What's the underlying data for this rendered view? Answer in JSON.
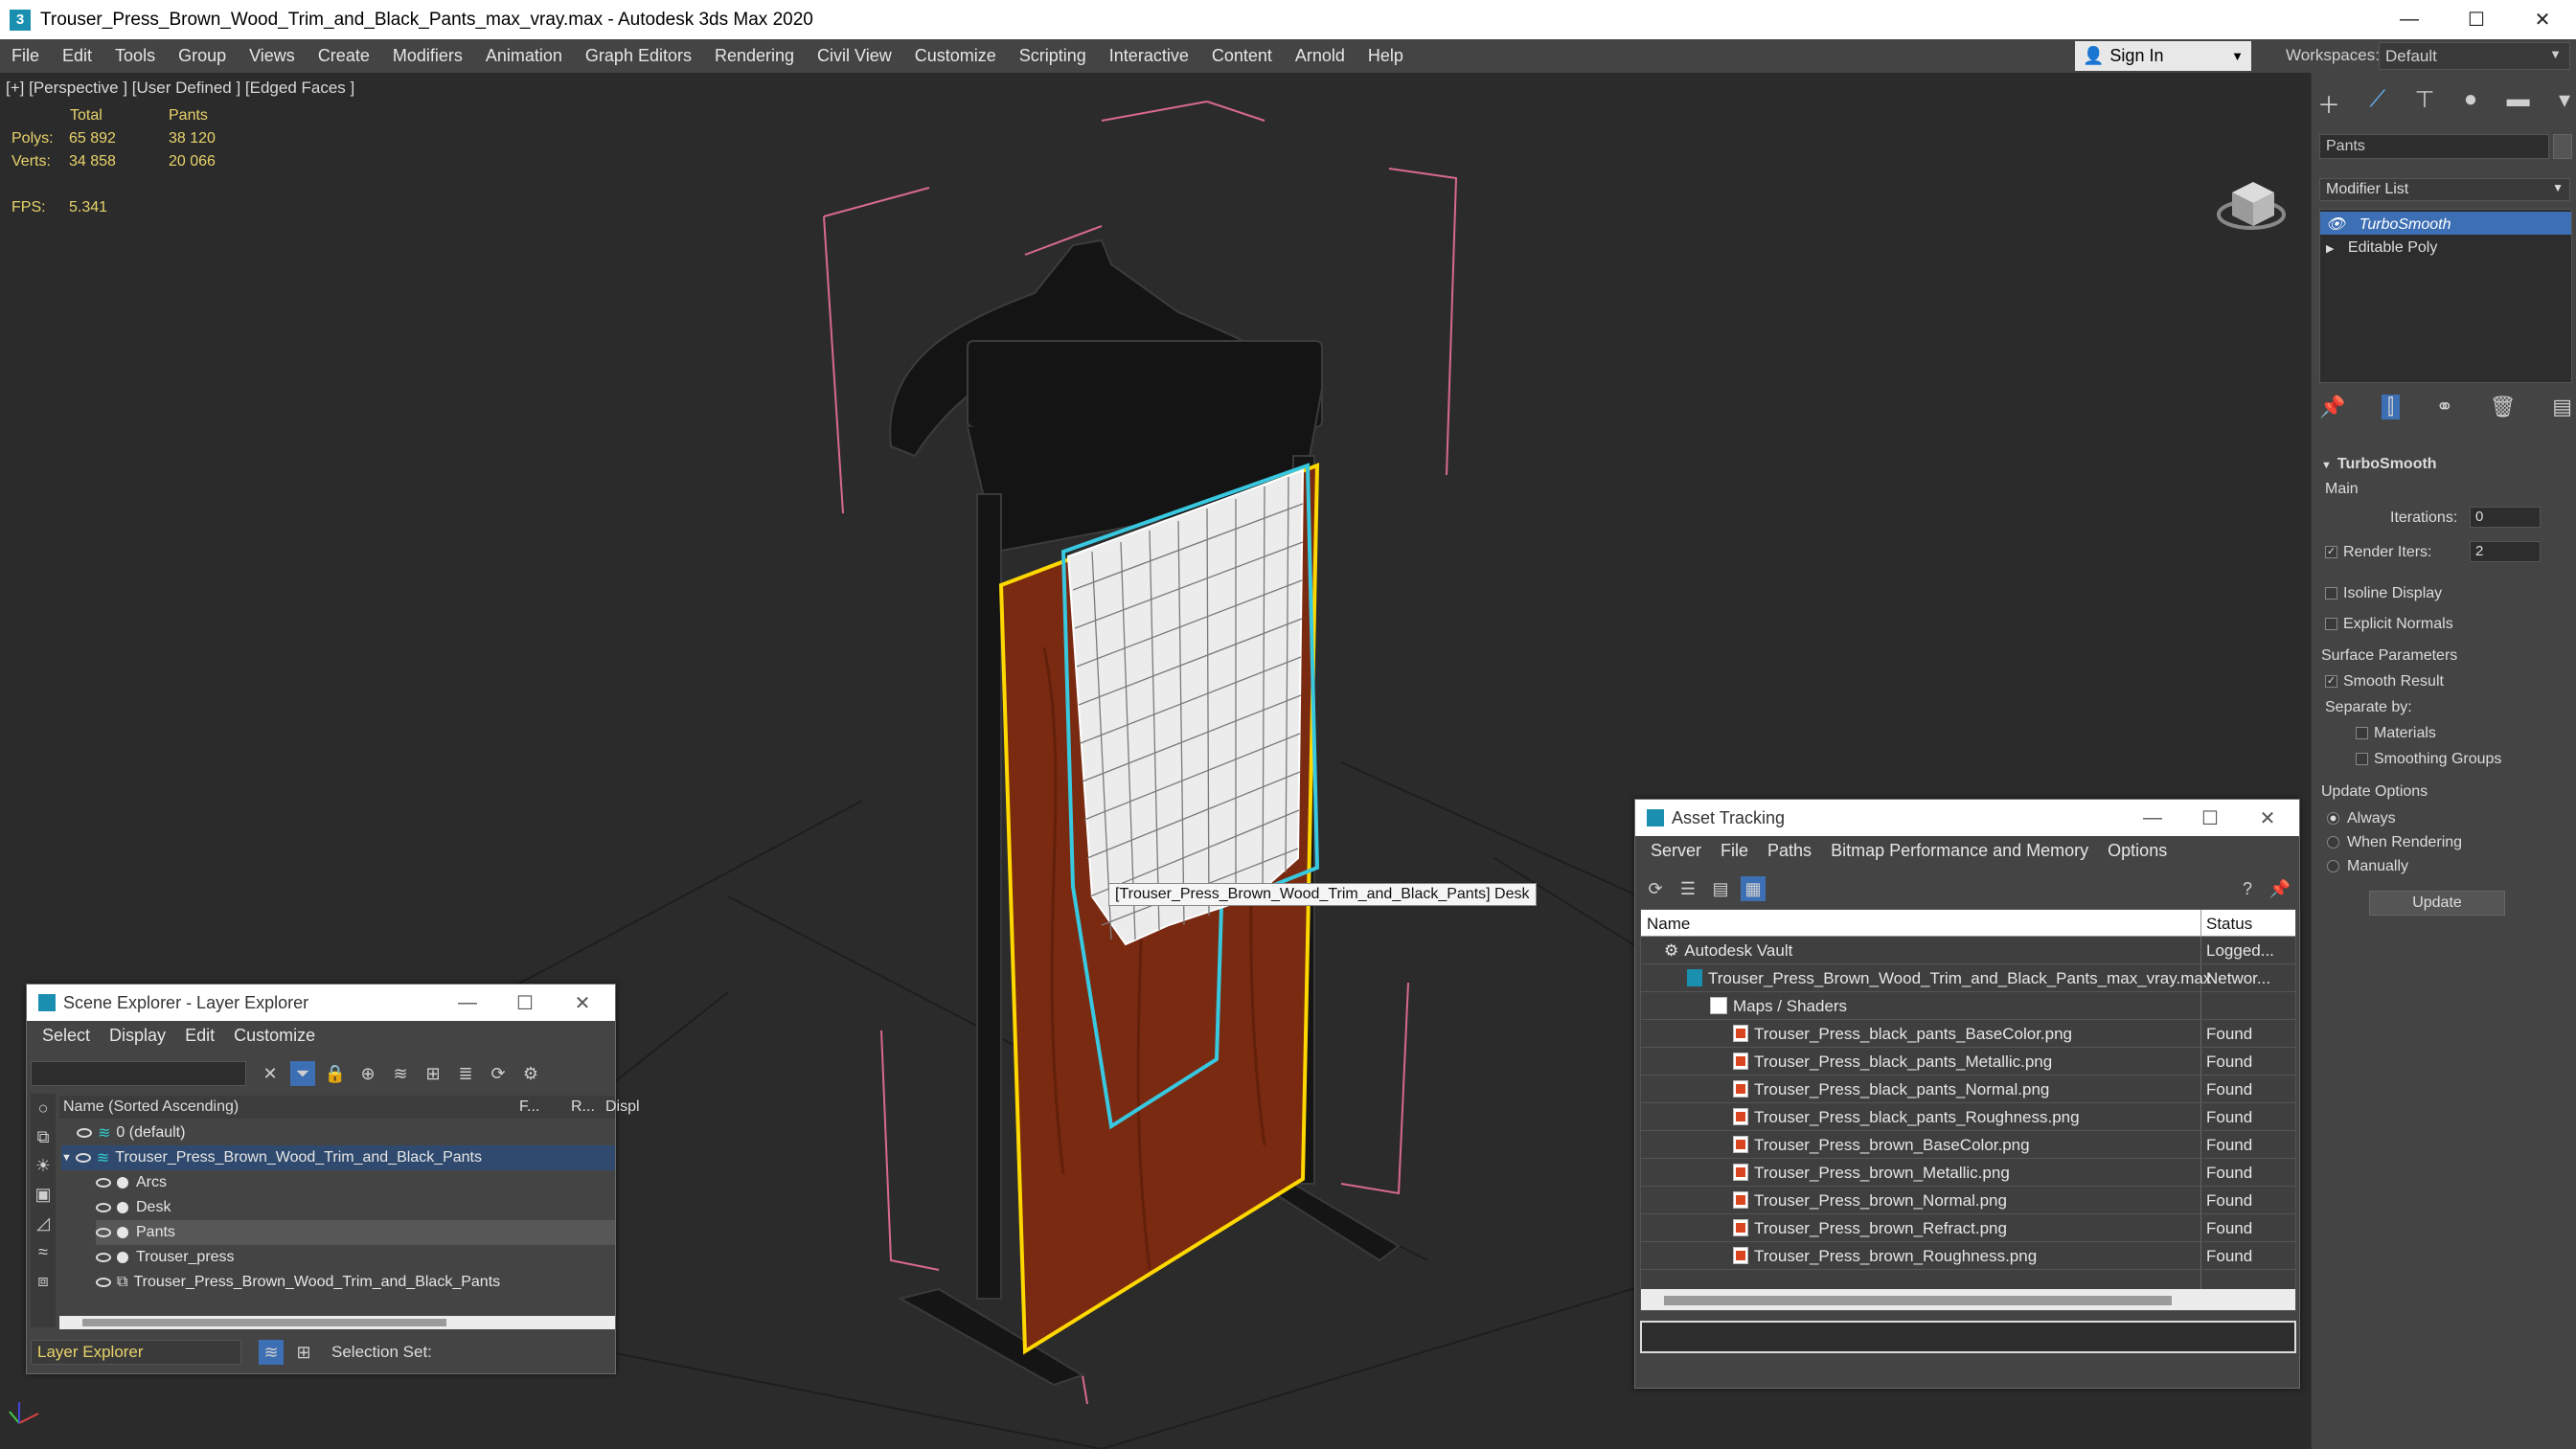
{
  "window": {
    "title": "Trouser_Press_Brown_Wood_Trim_and_Black_Pants_max_vray.max - Autodesk 3ds Max 2020",
    "minimize": "—",
    "maximize": "☐",
    "close": "✕"
  },
  "menu": [
    "File",
    "Edit",
    "Tools",
    "Group",
    "Views",
    "Create",
    "Modifiers",
    "Animation",
    "Graph Editors",
    "Rendering",
    "Civil View",
    "Customize",
    "Scripting",
    "Interactive",
    "Content",
    "Arnold",
    "Help"
  ],
  "signin": {
    "label": "Sign In"
  },
  "workspaces": {
    "label": "Workspaces:",
    "value": "Default"
  },
  "viewport": {
    "label": "[+] [Perspective ] [User Defined ] [Edged Faces ]",
    "stats": {
      "col_total": "Total",
      "col_pants": "Pants",
      "polys_label": "Polys:",
      "polys_total": "65 892",
      "polys_pants": "38 120",
      "verts_label": "Verts:",
      "verts_total": "34 858",
      "verts_pants": "20 066",
      "fps_label": "FPS:",
      "fps_value": "5.341"
    },
    "tooltip": "[Trouser_Press_Brown_Wood_Trim_and_Black_Pants] Desk"
  },
  "command_panel": {
    "object_name": "Pants",
    "modifier_list": "Modifier List",
    "stack": [
      "TurboSmooth",
      "Editable Poly"
    ],
    "rollout_title": "TurboSmooth",
    "main_label": "Main",
    "iterations_label": "Iterations:",
    "iterations_value": "0",
    "render_iters_label": "Render Iters:",
    "render_iters_value": "2",
    "isoline": "Isoline Display",
    "explicit_normals": "Explicit Normals",
    "surface_params": "Surface Parameters",
    "smooth_result": "Smooth Result",
    "separate_by": "Separate by:",
    "materials": "Materials",
    "smoothing_groups": "Smoothing Groups",
    "update_options": "Update Options",
    "always": "Always",
    "when_rendering": "When Rendering",
    "manually": "Manually",
    "update_button": "Update"
  },
  "scene_explorer": {
    "title": "Scene Explorer - Layer Explorer",
    "menu": [
      "Select",
      "Display",
      "Edit",
      "Customize"
    ],
    "col_name": "Name (Sorted Ascending)",
    "col_f": "F...",
    "col_r": "R...",
    "col_disp": "Displ",
    "rows": [
      "0 (default)",
      "Trouser_Press_Brown_Wood_Trim_and_Black_Pants",
      "Arcs",
      "Desk",
      "Pants",
      "Trouser_press",
      "Trouser_Press_Brown_Wood_Trim_and_Black_Pants"
    ],
    "footer_layer": "Layer Explorer",
    "footer_selection": "Selection Set:"
  },
  "asset_tracking": {
    "title": "Asset Tracking",
    "menu": [
      "Server",
      "File",
      "Paths",
      "Bitmap Performance and Memory",
      "Options"
    ],
    "col_name": "Name",
    "col_status": "Status",
    "rows": [
      {
        "name": "Autodesk Vault",
        "status": "Logged..."
      },
      {
        "name": "Trouser_Press_Brown_Wood_Trim_and_Black_Pants_max_vray.max",
        "status": "Networ..."
      },
      {
        "name": "Maps / Shaders",
        "status": ""
      },
      {
        "name": "Trouser_Press_black_pants_BaseColor.png",
        "status": "Found"
      },
      {
        "name": "Trouser_Press_black_pants_Metallic.png",
        "status": "Found"
      },
      {
        "name": "Trouser_Press_black_pants_Normal.png",
        "status": "Found"
      },
      {
        "name": "Trouser_Press_black_pants_Roughness.png",
        "status": "Found"
      },
      {
        "name": "Trouser_Press_brown_BaseColor.png",
        "status": "Found"
      },
      {
        "name": "Trouser_Press_brown_Metallic.png",
        "status": "Found"
      },
      {
        "name": "Trouser_Press_brown_Normal.png",
        "status": "Found"
      },
      {
        "name": "Trouser_Press_brown_Refract.png",
        "status": "Found"
      },
      {
        "name": "Trouser_Press_brown_Roughness.png",
        "status": "Found"
      }
    ]
  },
  "colors": {
    "selection_yellow": "#ffd800",
    "pants_cyan": "#38c8e0",
    "wood": "#7a2a10",
    "highlight_blue": "#3d6fb4"
  }
}
